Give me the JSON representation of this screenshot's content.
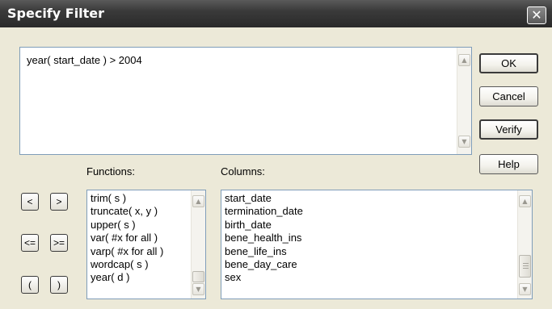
{
  "dialog": {
    "title": "Specify Filter",
    "close_glyph": "✕"
  },
  "expression": {
    "value": "year( start_date ) > 2004"
  },
  "buttons": {
    "ok": "OK",
    "cancel": "Cancel",
    "verify": "Verify",
    "help": "Help"
  },
  "labels": {
    "functions": "Functions:",
    "columns": "Columns:"
  },
  "operators": [
    "<",
    ">",
    "<=",
    ">=",
    "(",
    ")"
  ],
  "functions": [
    "trim( s )",
    "truncate( x, y )",
    "upper( s )",
    "var( #x for all )",
    "varp( #x for all )",
    "wordcap( s )",
    "year( d )"
  ],
  "columns": [
    "start_date",
    "termination_date",
    "birth_date",
    "bene_health_ins",
    "bene_life_ins",
    "bene_day_care",
    "sex"
  ],
  "scroll_glyphs": {
    "up": "▲",
    "down": "▼"
  },
  "colors": {
    "titlebar": "#3a3a3a",
    "dialog_bg": "#ece9d8",
    "field_border": "#7f9db9"
  }
}
